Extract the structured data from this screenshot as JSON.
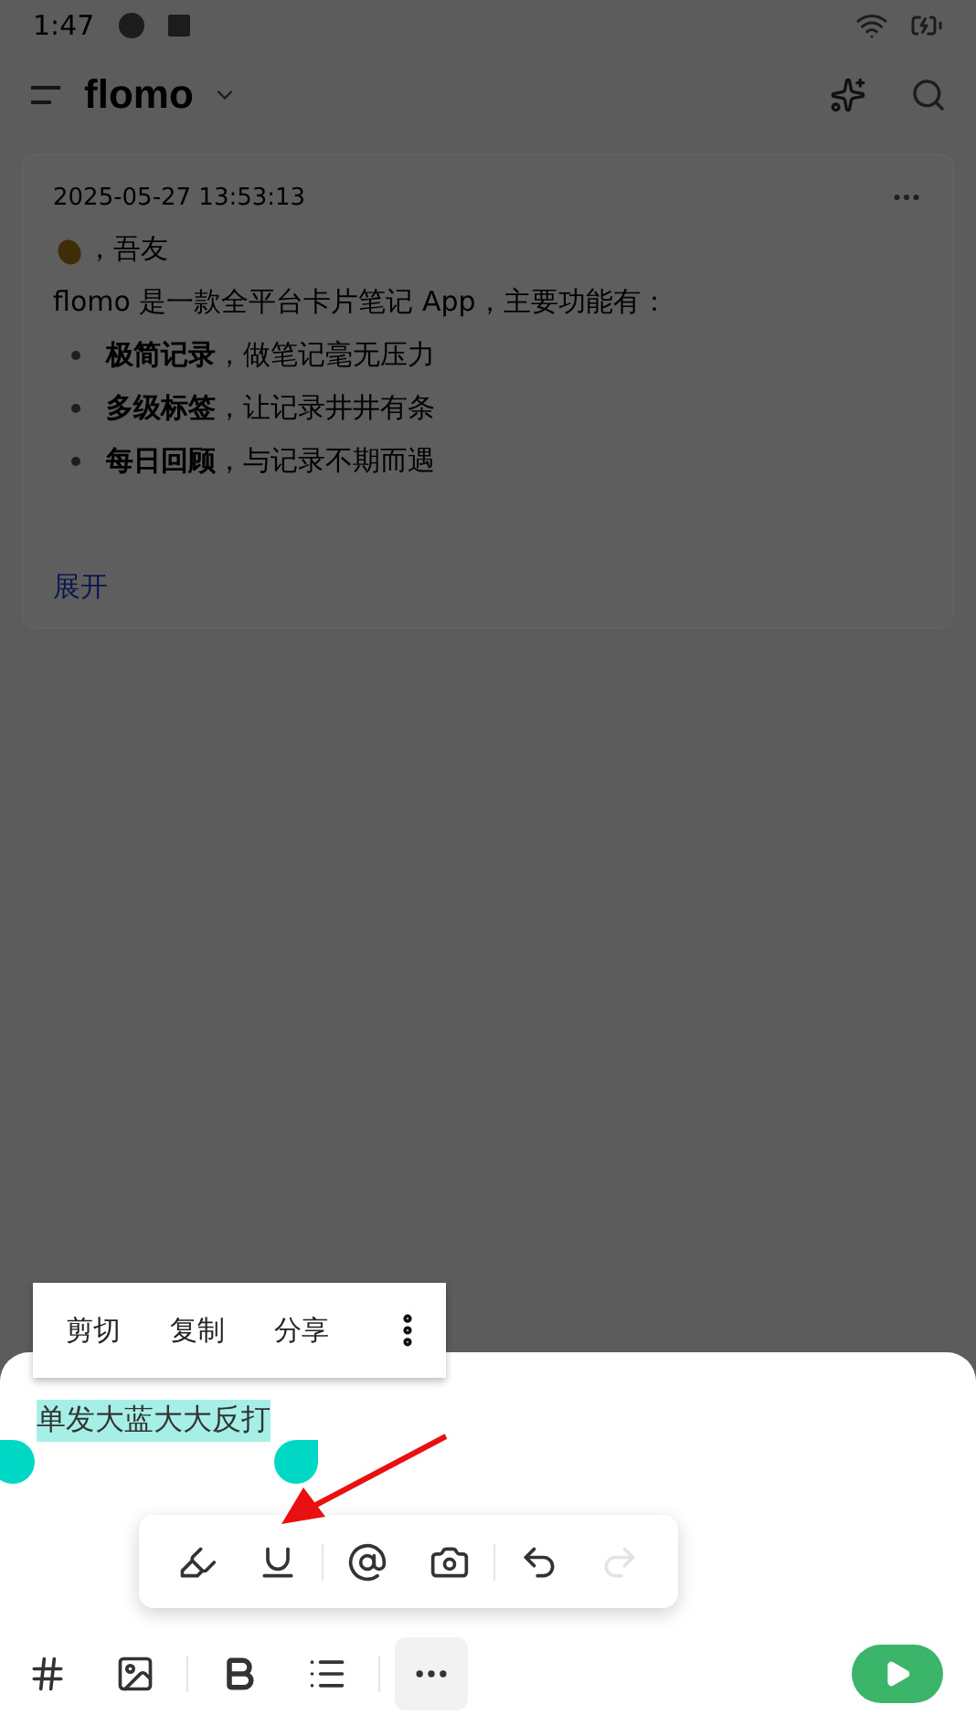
{
  "status_bar": {
    "time": "1:47"
  },
  "header": {
    "title": "flomo"
  },
  "memo": {
    "timestamp": "2025-05-27 13:53:13",
    "greeting": "，吾友",
    "intro": "flomo 是一款全平台卡片笔记 App，主要功能有：",
    "bullets": [
      "**极简记录**，做笔记毫无压力",
      "**多级标签**，让记录井井有条",
      "**每日回顾**，与记录不期而遇"
    ],
    "expand": "展开"
  },
  "context_menu": [
    "剪切",
    "复制",
    "分享"
  ],
  "editor": {
    "selected_text": "单发大蓝大大反打"
  },
  "format_toolbar": [
    [
      {
        "kind": "highlight",
        "disabled": false
      },
      {
        "kind": "underline",
        "disabled": false
      }
    ],
    [
      {
        "kind": "mention",
        "disabled": false
      },
      {
        "kind": "camera",
        "disabled": false
      }
    ],
    [
      {
        "kind": "undo",
        "disabled": false
      },
      {
        "kind": "redo",
        "disabled": true
      }
    ]
  ],
  "bottom_toolbar": [
    [
      {
        "kind": "tag",
        "selected": false
      },
      {
        "kind": "image",
        "selected": false
      }
    ],
    [
      {
        "kind": "bold",
        "selected": false
      },
      {
        "kind": "list",
        "selected": false
      }
    ],
    [
      {
        "kind": "more",
        "selected": true
      }
    ]
  ]
}
